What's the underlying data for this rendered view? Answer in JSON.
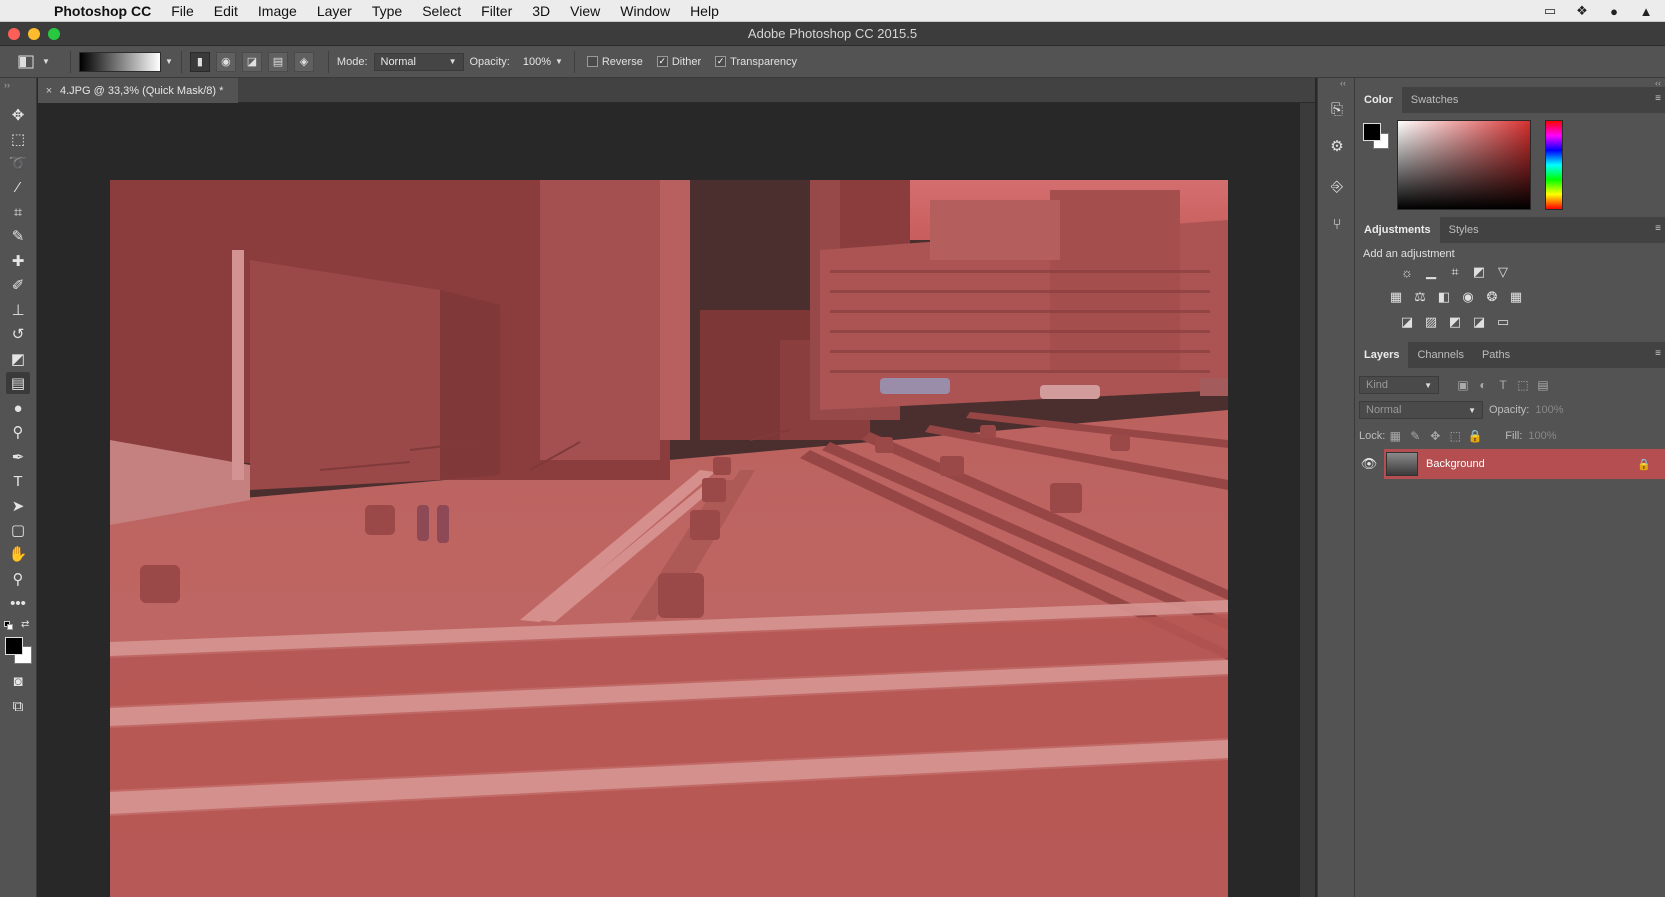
{
  "menubar": {
    "app_name": "Photoshop CC",
    "items": [
      "File",
      "Edit",
      "Image",
      "Layer",
      "Type",
      "Select",
      "Filter",
      "3D",
      "View",
      "Window",
      "Help"
    ]
  },
  "window": {
    "title": "Adobe Photoshop CC 2015.5"
  },
  "options": {
    "mode_label": "Mode:",
    "mode_value": "Normal",
    "opacity_label": "Opacity:",
    "opacity_value": "100%",
    "reverse_label": "Reverse",
    "reverse_checked": false,
    "dither_label": "Dither",
    "dither_checked": true,
    "transparency_label": "Transparency",
    "transparency_checked": true
  },
  "document": {
    "tab_title": "4.JPG @ 33,3% (Quick Mask/8) *",
    "close_glyph": "×"
  },
  "color_panel": {
    "tabs": [
      "Color",
      "Swatches"
    ],
    "active_tab": "Color",
    "foreground": "#000000",
    "background": "#ffffff"
  },
  "adjustments_panel": {
    "tabs": [
      "Adjustments",
      "Styles"
    ],
    "label": "Add an adjustment"
  },
  "layers_panel": {
    "tabs": [
      "Layers",
      "Channels",
      "Paths"
    ],
    "kind_placeholder": "Kind",
    "blend_mode": "Normal",
    "opacity_label": "Opacity:",
    "opacity_value": "100%",
    "lock_label": "Lock:",
    "fill_label": "Fill:",
    "fill_value": "100%",
    "layers": [
      {
        "name": "Background",
        "visible": true,
        "locked": true
      }
    ]
  },
  "colors": {
    "quick_mask_overlay": "#c84a4a",
    "selected_layer": "#b54e50"
  }
}
